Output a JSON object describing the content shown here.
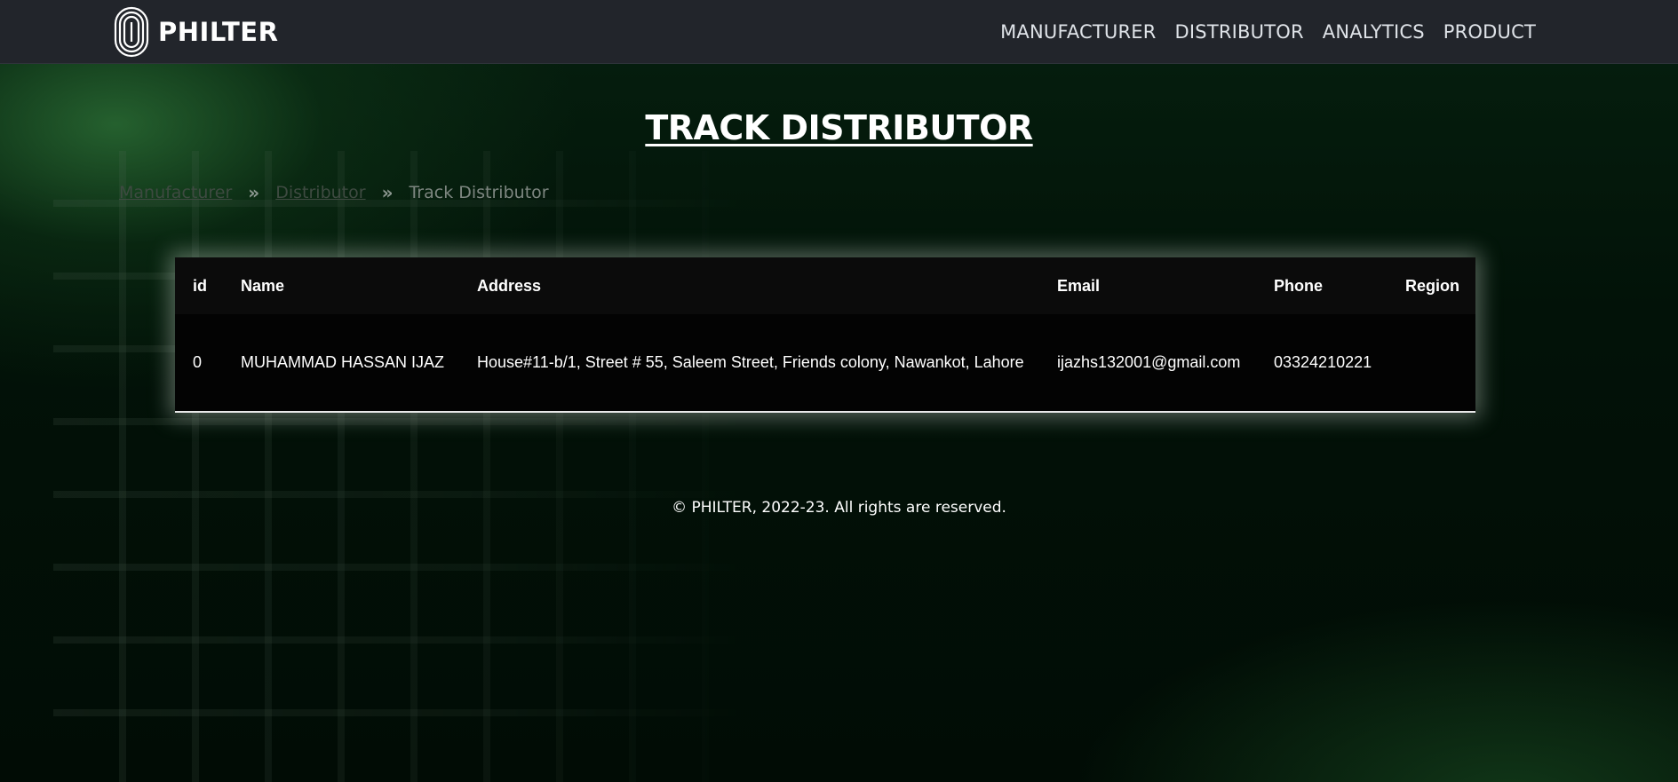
{
  "navbar": {
    "brand": "PHILTER",
    "logo_icon": "fingerprint-icon",
    "links": [
      "MANUFACTURER",
      "DISTRIBUTOR",
      "ANALYTICS",
      "PRODUCT"
    ]
  },
  "page_title": "TRACK DISTRIBUTOR",
  "breadcrumb": {
    "items": [
      "Manufacturer",
      "Distributor"
    ],
    "current": "Track Distributor",
    "separator_icon": "double-chevron-right-icon"
  },
  "table": {
    "columns": [
      "id",
      "Name",
      "Address",
      "Email",
      "Phone",
      "Region"
    ],
    "rows": [
      [
        "0",
        "MUHAMMAD HASSAN IJAZ",
        "House#11-b/1, Street # 55, Saleem Street, Friends colony, Nawankot, Lahore",
        "ijazhs132001@gmail.com",
        "03324210221",
        ""
      ]
    ]
  },
  "footer": {
    "text": "© PHILTER, 2022-23. All rights are reserved."
  },
  "colors": {
    "navbar_bg": "#22252b",
    "page_bg": "#02140a",
    "accent_green": "#30783a",
    "text": "#ffffff"
  }
}
